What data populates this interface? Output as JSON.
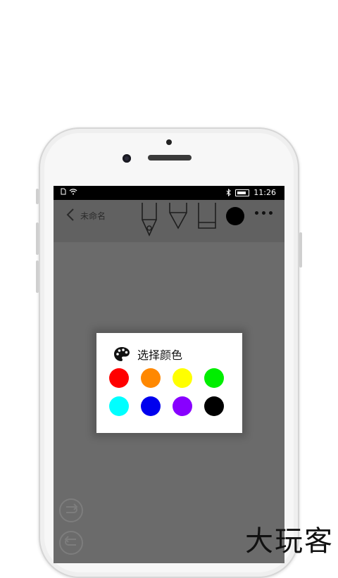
{
  "statusbar": {
    "time": "11:26"
  },
  "toolbar": {
    "title": "未命名"
  },
  "dialog": {
    "title": "选择颜色",
    "colors": [
      "#ff0000",
      "#ff8800",
      "#ffff00",
      "#00ee00",
      "#00ffff",
      "#0000ee",
      "#8800ff",
      "#000000"
    ]
  },
  "watermark": "大玩客"
}
